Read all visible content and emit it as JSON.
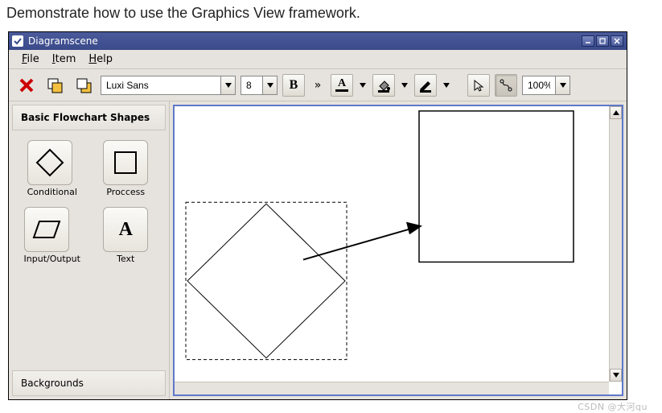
{
  "intro": "Demonstrate how to use the Graphics View framework.",
  "window": {
    "title": "Diagramscene"
  },
  "menu": {
    "file": "File",
    "item": "Item",
    "help": "Help"
  },
  "toolbar": {
    "font_family": "Luxi Sans",
    "font_size": "8",
    "zoom": "100%"
  },
  "sidebar": {
    "section1": "Basic Flowchart Shapes",
    "shapes": {
      "conditional": "Conditional",
      "process": "Proccess",
      "io": "Input/Output",
      "text": "Text",
      "text_glyph": "A"
    },
    "section2": "Backgrounds"
  },
  "icons": {
    "bold": "B",
    "more": "»",
    "textcolor": "A"
  },
  "watermark": "CSDN @大河qu"
}
